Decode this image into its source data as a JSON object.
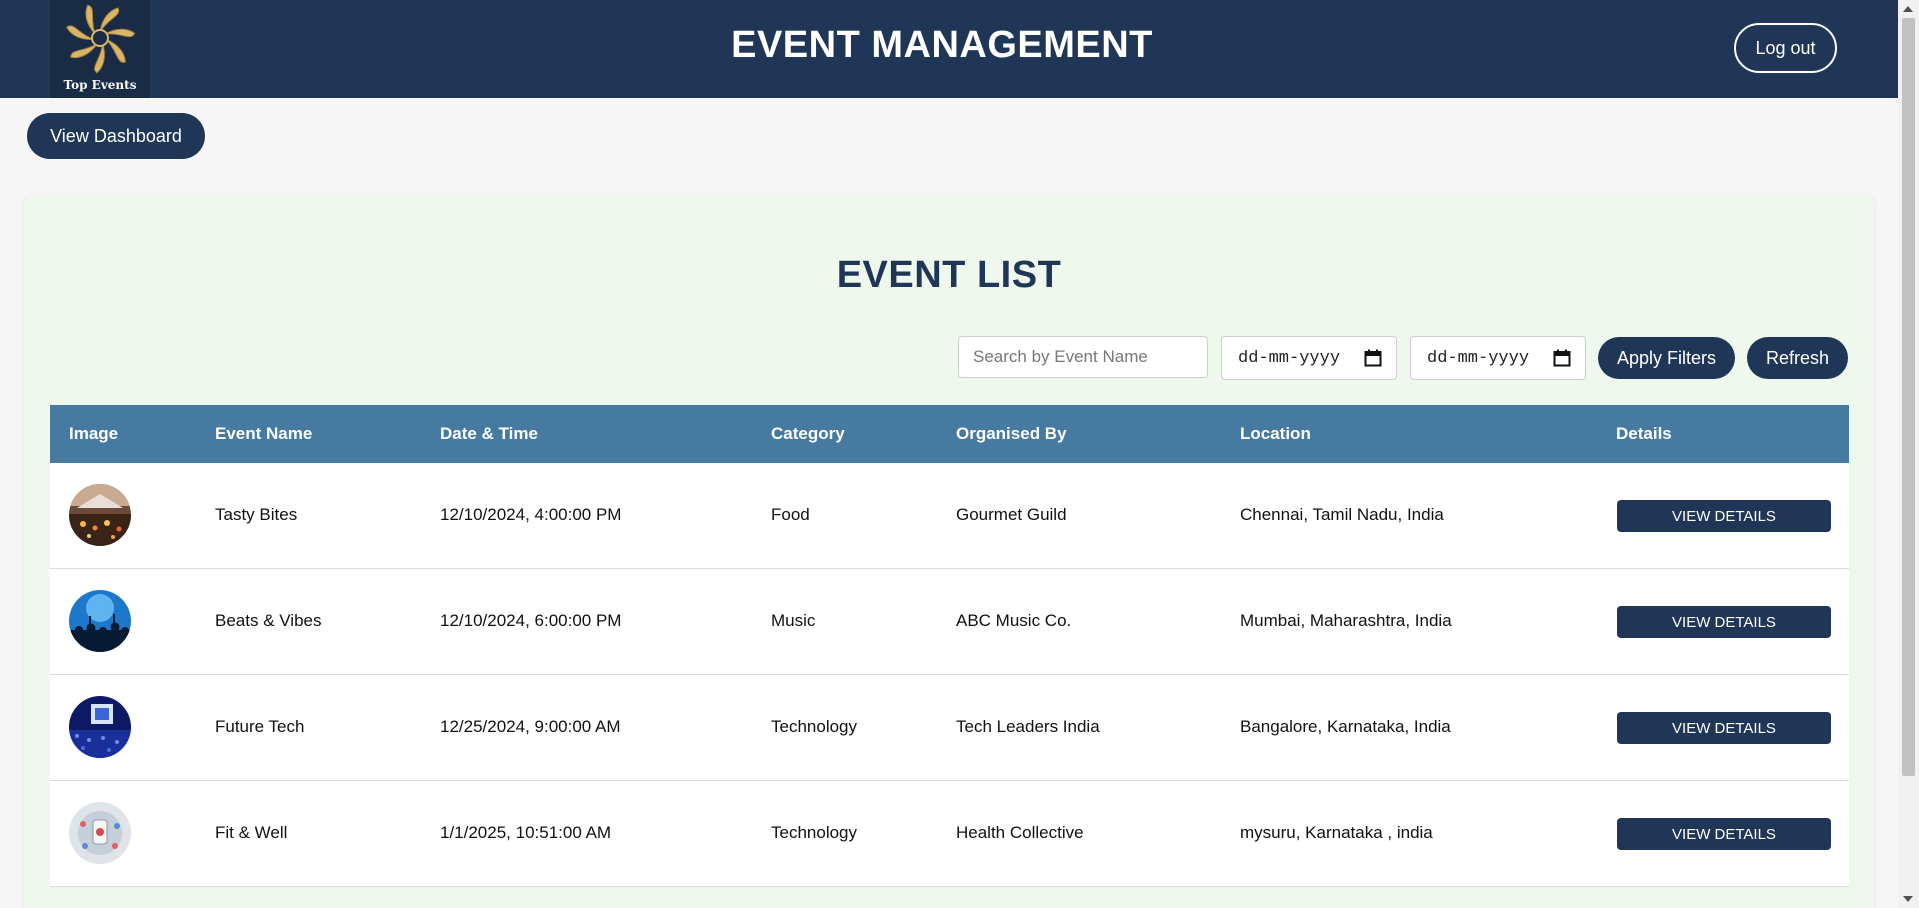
{
  "header": {
    "logo_text": "Top Events",
    "title": "EVENT MANAGEMENT",
    "logout_label": "Log out"
  },
  "dashboard_button": "View Dashboard",
  "panel": {
    "title": "EVENT LIST",
    "filters": {
      "search_placeholder": "Search by Event Name",
      "start_date": "dd-mm-yyyy",
      "end_date": "dd-mm-yyyy",
      "apply_label": "Apply Filters",
      "refresh_label": "Refresh"
    }
  },
  "table": {
    "columns": [
      "Image",
      "Event Name",
      "Date & Time",
      "Category",
      "Organised By",
      "Location",
      "Details"
    ],
    "rows": [
      {
        "image": "food-event-thumbnail",
        "name": "Tasty Bites",
        "datetime": "12/10/2024, 4:00:00 PM",
        "category": "Food",
        "organiser": "Gourmet Guild",
        "location": "Chennai, Tamil Nadu, India",
        "action": "VIEW DETAILS"
      },
      {
        "image": "music-concert-thumbnail",
        "name": "Beats & Vibes",
        "datetime": "12/10/2024, 6:00:00 PM",
        "category": "Music",
        "organiser": "ABC Music Co.",
        "location": "Mumbai, Maharashtra, India",
        "action": "VIEW DETAILS"
      },
      {
        "image": "tech-conference-thumbnail",
        "name": "Future Tech",
        "datetime": "12/25/2024, 9:00:00 AM",
        "category": "Technology",
        "organiser": "Tech Leaders India",
        "location": "Bangalore, Karnataka, India",
        "action": "VIEW DETAILS"
      },
      {
        "image": "health-tech-thumbnail",
        "name": "Fit & Well",
        "datetime": "1/1/2025, 10:51:00 AM",
        "category": "Technology",
        "organiser": "Health Collective",
        "location": "mysuru, Karnataka , india",
        "action": "VIEW DETAILS"
      }
    ]
  },
  "colors": {
    "navy": "#1f3657",
    "table_header": "#467aa0",
    "panel_bg": "#eef8ec",
    "logo_gold": "#d9b56a"
  }
}
